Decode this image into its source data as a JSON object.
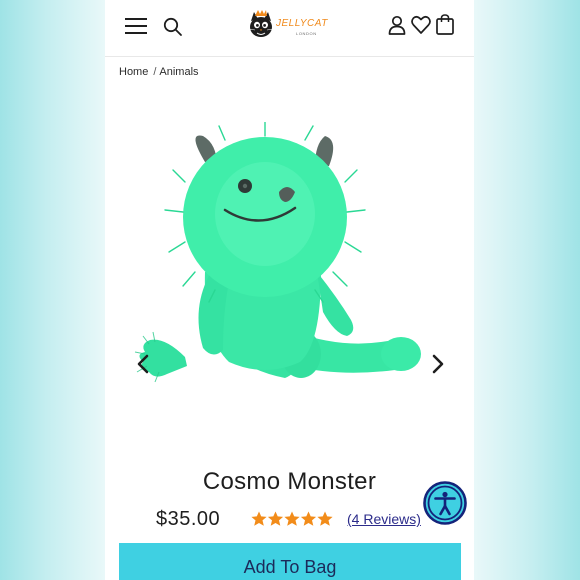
{
  "header": {
    "brand": "JELLYCAT",
    "brand_sub": "LONDON",
    "icons": [
      "menu-icon",
      "search-icon",
      "account-icon",
      "heart-icon",
      "bag-icon"
    ]
  },
  "breadcrumb": {
    "items": [
      "Home",
      "Animals"
    ],
    "separator": "/"
  },
  "product": {
    "title": "Cosmo Monster",
    "price": "$35.00",
    "rating": 5,
    "reviews_label": "(4 Reviews)",
    "add_to_bag_label": "Add To Bag",
    "image_name": "cosmo-monster-plush"
  },
  "colors": {
    "accent": "#3fd0e2",
    "star": "#f28c1a",
    "plush_green": "#35e4a0",
    "logo_orange": "#f08a1c",
    "a11y_ring": "#14237a",
    "a11y_fill": "#3fd0e2"
  }
}
